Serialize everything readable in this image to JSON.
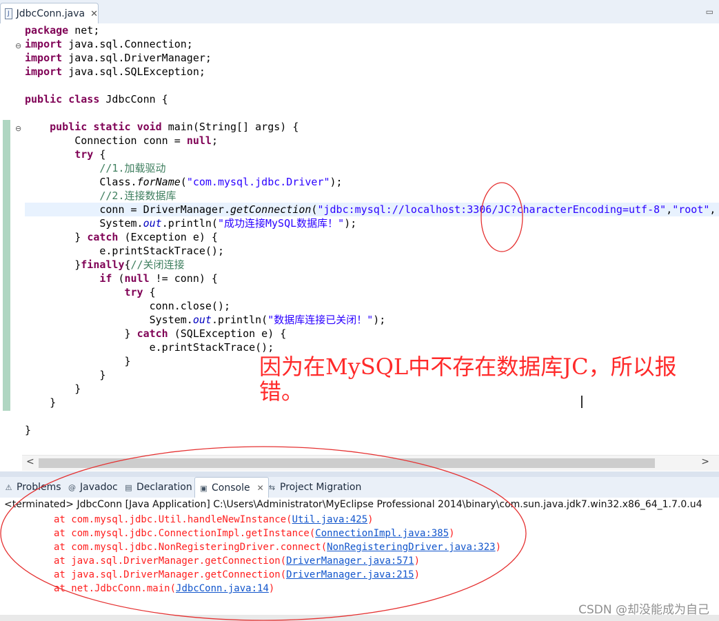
{
  "editor_tab": {
    "filename": "JdbcConn.java",
    "close": "✕",
    "icon": "java-file-icon"
  },
  "code_lines": [
    [
      {
        "t": "package",
        "c": "kw"
      },
      {
        "t": " net;"
      }
    ],
    [
      {
        "t": "import",
        "c": "kw"
      },
      {
        "t": " java.sql.Connection;"
      }
    ],
    [
      {
        "t": "import",
        "c": "kw"
      },
      {
        "t": " java.sql.DriverManager;"
      }
    ],
    [
      {
        "t": "import",
        "c": "kw"
      },
      {
        "t": " java.sql.SQLException;"
      }
    ],
    [],
    [
      {
        "t": "public",
        "c": "kw"
      },
      {
        "t": " "
      },
      {
        "t": "class",
        "c": "kw"
      },
      {
        "t": " JdbcConn {"
      }
    ],
    [],
    [
      {
        "t": "    "
      },
      {
        "t": "public",
        "c": "kw"
      },
      {
        "t": " "
      },
      {
        "t": "static",
        "c": "kw"
      },
      {
        "t": " "
      },
      {
        "t": "void",
        "c": "kw"
      },
      {
        "t": " main(String[] args) {"
      }
    ],
    [
      {
        "t": "        Connection conn = "
      },
      {
        "t": "null",
        "c": "kw"
      },
      {
        "t": ";"
      }
    ],
    [
      {
        "t": "        "
      },
      {
        "t": "try",
        "c": "kw"
      },
      {
        "t": " {"
      }
    ],
    [
      {
        "t": "            "
      },
      {
        "t": "//1.加载驱动",
        "c": "cmt"
      }
    ],
    [
      {
        "t": "            Class."
      },
      {
        "t": "forName",
        "c": "it"
      },
      {
        "t": "("
      },
      {
        "t": "\"com.mysql.jdbc.Driver\"",
        "c": "str"
      },
      {
        "t": ");"
      }
    ],
    [
      {
        "t": "            "
      },
      {
        "t": "//2.连接数据库",
        "c": "cmt"
      }
    ],
    [
      {
        "t": "            conn = DriverManager."
      },
      {
        "t": "getConnection",
        "c": "it"
      },
      {
        "t": "("
      },
      {
        "t": "\"jdbc:mysql://localhost:3306/JC?characterEncoding=utf-8\"",
        "c": "str"
      },
      {
        "t": ","
      },
      {
        "t": "\"root\"",
        "c": "str"
      },
      {
        "t": ","
      }
    ],
    [
      {
        "t": "            System."
      },
      {
        "t": "out",
        "c": "fld"
      },
      {
        "t": ".println("
      },
      {
        "t": "\"成功连接MySQL数据库！\"",
        "c": "str"
      },
      {
        "t": ");"
      }
    ],
    [
      {
        "t": "        } "
      },
      {
        "t": "catch",
        "c": "kw"
      },
      {
        "t": " (Exception e) {"
      }
    ],
    [
      {
        "t": "            e.printStackTrace();"
      }
    ],
    [
      {
        "t": "        }"
      },
      {
        "t": "finally",
        "c": "kw"
      },
      {
        "t": "{"
      },
      {
        "t": "//关闭连接",
        "c": "cmt"
      }
    ],
    [
      {
        "t": "            "
      },
      {
        "t": "if",
        "c": "kw"
      },
      {
        "t": " ("
      },
      {
        "t": "null",
        "c": "kw"
      },
      {
        "t": " != conn) {"
      }
    ],
    [
      {
        "t": "                "
      },
      {
        "t": "try",
        "c": "kw"
      },
      {
        "t": " {"
      }
    ],
    [
      {
        "t": "                    conn.close();"
      }
    ],
    [
      {
        "t": "                    System."
      },
      {
        "t": "out",
        "c": "fld"
      },
      {
        "t": ".println("
      },
      {
        "t": "\"数据库连接已关闭！\"",
        "c": "str"
      },
      {
        "t": ");"
      }
    ],
    [
      {
        "t": "                } "
      },
      {
        "t": "catch",
        "c": "kw"
      },
      {
        "t": " (SQLException e) {"
      }
    ],
    [
      {
        "t": "                    e.printStackTrace();"
      }
    ],
    [
      {
        "t": "                }"
      }
    ],
    [
      {
        "t": "            }"
      }
    ],
    [
      {
        "t": "        }"
      }
    ],
    [
      {
        "t": "    }"
      }
    ],
    [],
    [
      {
        "t": "}"
      }
    ]
  ],
  "annotation": "因为在MySQL中不存在数据库JC，所以报错。",
  "panel_tabs": [
    {
      "label": "Problems",
      "icon": "problems-icon"
    },
    {
      "label": "Javadoc",
      "icon": "javadoc-icon"
    },
    {
      "label": "Declaration",
      "icon": "declaration-icon"
    },
    {
      "label": "Console",
      "icon": "console-icon",
      "active": true
    },
    {
      "label": "Project Migration",
      "icon": "migration-icon"
    }
  ],
  "console": {
    "status": "<terminated> JdbcConn [Java Application] C:\\Users\\Administrator\\MyEclipse Professional 2014\\binary\\com.sun.java.jdk7.win32.x86_64_1.7.0.u4",
    "trace": [
      {
        "prefix": "at com.mysql.jdbc.Util.handleNewInstance(",
        "link": "Util.java:425",
        "suffix": ")"
      },
      {
        "prefix": "at com.mysql.jdbc.ConnectionImpl.getInstance(",
        "link": "ConnectionImpl.java:385",
        "suffix": ")"
      },
      {
        "prefix": "at com.mysql.jdbc.NonRegisteringDriver.connect(",
        "link": "NonRegisteringDriver.java:323",
        "suffix": ")"
      },
      {
        "prefix": "at java.sql.DriverManager.getConnection(",
        "link": "DriverManager.java:571",
        "suffix": ")"
      },
      {
        "prefix": "at java.sql.DriverManager.getConnection(",
        "link": "DriverManager.java:215",
        "suffix": ")"
      },
      {
        "prefix": "at net.JdbcConn.main(",
        "link": "JdbcConn.java:14",
        "suffix": ")"
      }
    ]
  },
  "watermark": "CSDN @却没能成为自己",
  "colors": {
    "annotation": "#ff2a2a",
    "keyword": "#7f0055",
    "string": "#2a00ff",
    "comment": "#3f7f5f",
    "link": "#1155cc"
  }
}
